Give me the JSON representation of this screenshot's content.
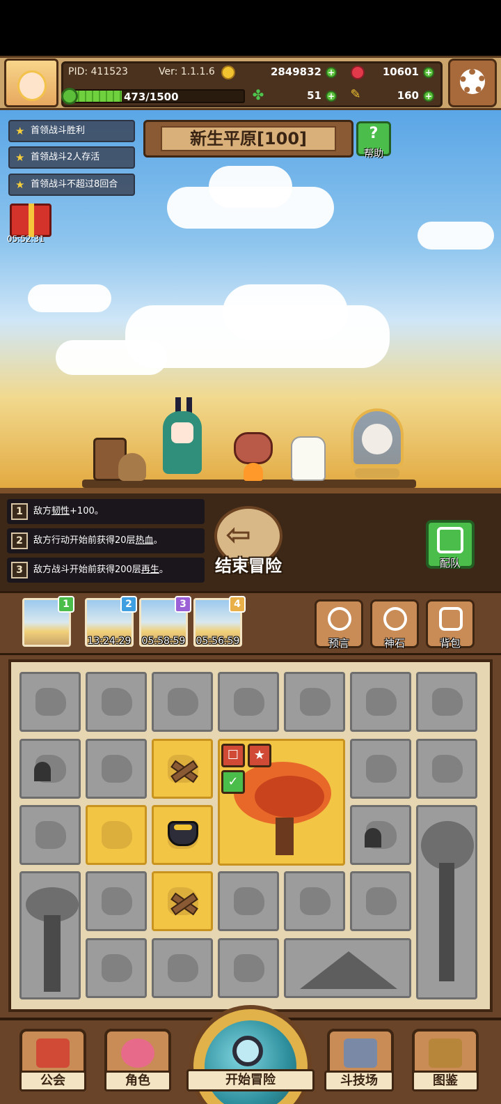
{
  "header": {
    "pid": "PID: 411523",
    "version": "Ver: 1.1.1.6",
    "gold": "2849832",
    "ruby": "10601",
    "exp": "473/1500",
    "exp_fraction": 0.315,
    "clover": "51",
    "key": "160"
  },
  "quests": [
    {
      "label": "首领战斗胜利"
    },
    {
      "label": "首领战斗2人存活"
    },
    {
      "label": "首领战斗不超过8回合"
    }
  ],
  "gift_timer": "05:52:31",
  "zone": {
    "title": "新生平原[100]",
    "help_label": "帮助"
  },
  "effects": [
    {
      "num": "1",
      "pre": "敌方",
      "key": "韧性",
      "post": "+100。"
    },
    {
      "num": "2",
      "pre": "敌方行动开始前获得20层",
      "key": "热血",
      "post": "。"
    },
    {
      "num": "3",
      "pre": "敌方战斗开始前获得200层",
      "key": "再生",
      "post": "。"
    }
  ],
  "end_button": "结束冒险",
  "team_button": "配队",
  "cards": [
    {
      "badge": "1",
      "time": "",
      "badge_color": "#4bbd4b"
    },
    {
      "badge": "2",
      "time": "13:24:29",
      "badge_color": "#3f9fe0"
    },
    {
      "badge": "3",
      "time": "05:58:59",
      "badge_color": "#9b5fd6"
    },
    {
      "badge": "4",
      "time": "05:56:59",
      "badge_color": "#e9b04a"
    }
  ],
  "tools": [
    {
      "label": "预言",
      "icon": "prophecy-icon"
    },
    {
      "label": "神石",
      "icon": "godstone-icon"
    },
    {
      "label": "背包",
      "icon": "backpack-icon"
    }
  ],
  "nav": {
    "guild": "公会",
    "character": "角色",
    "start": "开始冒险",
    "arena": "斗技场",
    "codex": "图鉴"
  },
  "colors": {
    "header_bg": "#caa46a",
    "lit_tile": "#f3c544",
    "dim_tile": "#9c9c9c",
    "plus_green": "#5bbf3a",
    "ruby": "#e23a4a",
    "gold": "#f1c331"
  }
}
